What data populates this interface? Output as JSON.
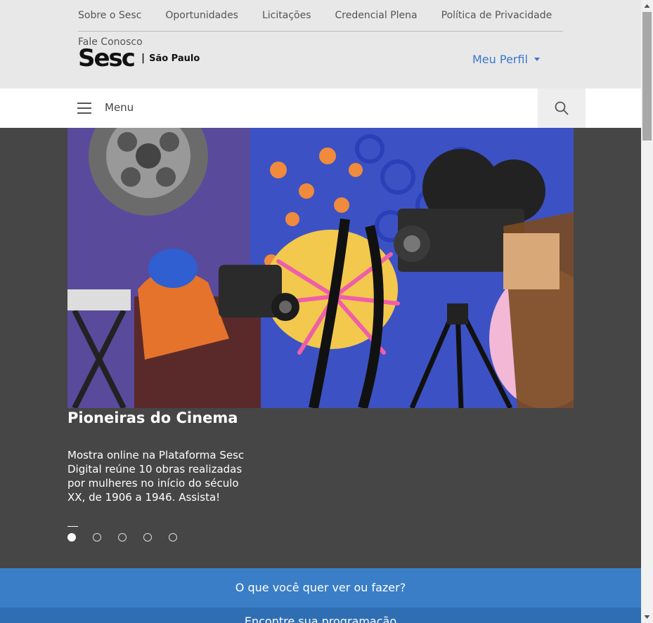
{
  "header": {
    "top_links": [
      "Sobre o Sesc",
      "Oportunidades",
      "Licitações",
      "Credencial Plena",
      "Política de Privacidade"
    ],
    "contact_link": "Fale Conosco",
    "logo_word": "Sesc",
    "logo_separator": "|",
    "logo_city": "São Paulo",
    "profile_label": "Meu Perfil"
  },
  "menubar": {
    "menu_label": "Menu"
  },
  "hero": {
    "title": "Pioneiras do Cinema",
    "description": "Mostra online na Plataforma Sesc Digital reúne 10 obras realizadas por mulheres no início do século XX, de 1906 a 1946. Assista!",
    "slide_count": 5,
    "active_slide": 1
  },
  "cta": {
    "primary": "O que você quer ver ou fazer?",
    "secondary": "Encontre sua programação"
  },
  "colors": {
    "accent": "#3a7ec7",
    "accent_dark": "#2f6eb3",
    "hero_bg": "#464646",
    "link": "#3a77c9"
  }
}
